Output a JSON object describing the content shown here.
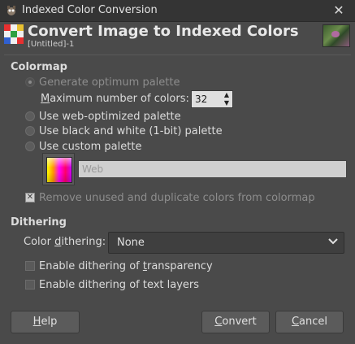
{
  "window": {
    "title": "Indexed Color Conversion",
    "close_glyph": "✕"
  },
  "header": {
    "title": "Convert Image to Indexed Colors",
    "subtitle": "[Untitled]-1"
  },
  "colormap": {
    "section_title": "Colormap",
    "generate_optimum": "Generate optimum palette",
    "max_colors_label_pre": "",
    "max_colors_mnemonic": "M",
    "max_colors_label_post": "aximum number of colors:",
    "max_colors_value": "32",
    "web_optimized": "Use web-optimized palette",
    "black_white": "Use black and white (1-bit) palette",
    "custom_palette": "Use custom palette",
    "palette_name": "Web",
    "remove_unused": "Remove unused and duplicate colors from colormap"
  },
  "dithering": {
    "section_title": "Dithering",
    "color_dithering_pre": "Color ",
    "color_dithering_mnemonic": "d",
    "color_dithering_post": "ithering:",
    "color_dithering_value": "None",
    "transparency_pre": "Enable dithering of ",
    "transparency_mnemonic": "t",
    "transparency_post": "ransparency",
    "text_layers": "Enable dithering of text layers"
  },
  "buttons": {
    "help_mnemonic": "H",
    "help_rest": "elp",
    "convert_mnemonic": "C",
    "convert_rest": "onvert",
    "cancel_mnemonic": "C",
    "cancel_rest": "ancel"
  },
  "icons": {
    "app": "gimp-icon",
    "header": "indexed-color-icon",
    "close": "close-icon",
    "combo": "chevron-down-icon"
  }
}
